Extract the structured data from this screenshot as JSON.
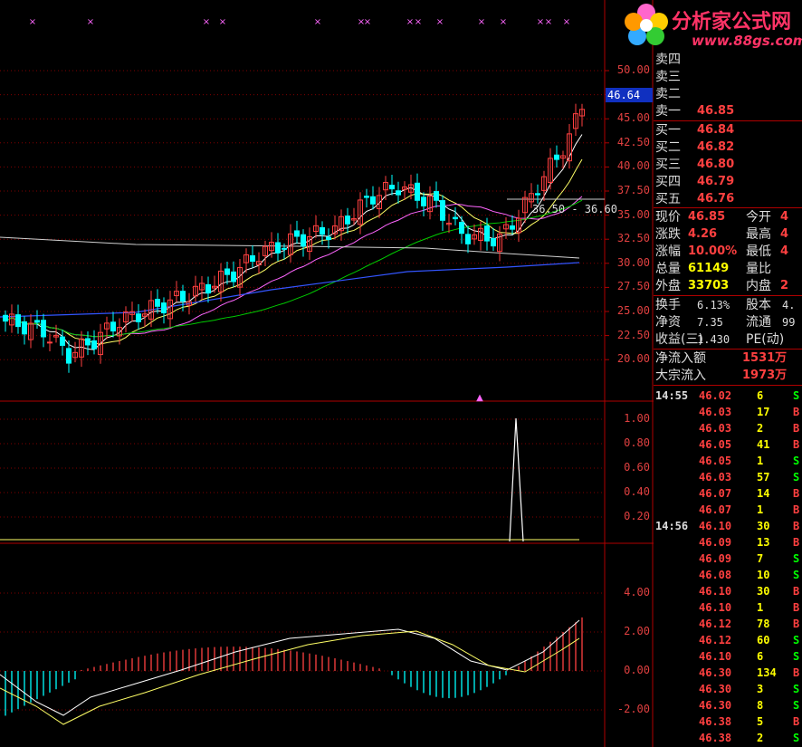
{
  "logo": {
    "title": "分析家公式网",
    "url": "www.88gs.com"
  },
  "main_panel": {
    "current_price_tag": "46.64",
    "range_label": "36.50 - 36.60",
    "y_ticks": [
      "50.00",
      "47.50",
      "45.00",
      "42.50",
      "40.00",
      "37.50",
      "35.00",
      "32.50",
      "30.00",
      "27.50",
      "25.00",
      "22.50",
      "20.00"
    ]
  },
  "sub1_ticks": [
    "1.00",
    "0.80",
    "0.60",
    "0.40",
    "0.20"
  ],
  "sub2_ticks": [
    "4.00",
    "2.00",
    "0.00",
    "-2.00"
  ],
  "quote": {
    "sell": [
      {
        "label": "卖四",
        "price": ""
      },
      {
        "label": "卖三",
        "price": ""
      },
      {
        "label": "卖二",
        "price": ""
      },
      {
        "label": "卖一",
        "price": "46.85"
      }
    ],
    "buy": [
      {
        "label": "买一",
        "price": "46.84"
      },
      {
        "label": "买二",
        "price": "46.82"
      },
      {
        "label": "买三",
        "price": "46.80"
      },
      {
        "label": "买四",
        "price": "46.79"
      },
      {
        "label": "买五",
        "price": "46.76"
      }
    ],
    "stats": [
      {
        "l1": "现价",
        "v1": "46.85",
        "l2": "今开",
        "v2": "4"
      },
      {
        "l1": "涨跌",
        "v1": "4.26",
        "l2": "最高",
        "v2": "4"
      },
      {
        "l1": "涨幅",
        "v1": "10.00%",
        "l2": "最低",
        "v2": "4"
      },
      {
        "l1": "总量",
        "v1": "61149",
        "l2": "量比",
        "v2": ""
      },
      {
        "l1": "外盘",
        "v1": "33703",
        "l2": "内盘",
        "v2": "2"
      }
    ],
    "stats2": [
      {
        "l1": "换手",
        "v1": "6.13%",
        "l2": "股本",
        "v2": "4."
      },
      {
        "l1": "净资",
        "v1": "7.35",
        "l2": "流通",
        "v2": "99"
      },
      {
        "l1": "收益(三)",
        "v1": "1.430",
        "l2": "PE(动)",
        "v2": ""
      }
    ],
    "flow": [
      {
        "label": "净流入额",
        "value": "1531万"
      },
      {
        "label": "大宗流入",
        "value": "1973万"
      }
    ]
  },
  "ticks": [
    {
      "time": "14:55",
      "price": "46.02",
      "vol": "6",
      "side": "S"
    },
    {
      "time": "",
      "price": "46.03",
      "vol": "17",
      "side": "B"
    },
    {
      "time": "",
      "price": "46.03",
      "vol": "2",
      "side": "B"
    },
    {
      "time": "",
      "price": "46.05",
      "vol": "41",
      "side": "B"
    },
    {
      "time": "",
      "price": "46.05",
      "vol": "1",
      "side": "S"
    },
    {
      "time": "",
      "price": "46.03",
      "vol": "57",
      "side": "S"
    },
    {
      "time": "",
      "price": "46.07",
      "vol": "14",
      "side": "B"
    },
    {
      "time": "",
      "price": "46.07",
      "vol": "1",
      "side": "B"
    },
    {
      "time": "14:56",
      "price": "46.10",
      "vol": "30",
      "side": "B"
    },
    {
      "time": "",
      "price": "46.09",
      "vol": "13",
      "side": "B"
    },
    {
      "time": "",
      "price": "46.09",
      "vol": "7",
      "side": "S"
    },
    {
      "time": "",
      "price": "46.08",
      "vol": "10",
      "side": "S"
    },
    {
      "time": "",
      "price": "46.10",
      "vol": "30",
      "side": "B"
    },
    {
      "time": "",
      "price": "46.10",
      "vol": "1",
      "side": "B"
    },
    {
      "time": "",
      "price": "46.12",
      "vol": "78",
      "side": "B"
    },
    {
      "time": "",
      "price": "46.12",
      "vol": "60",
      "side": "S"
    },
    {
      "time": "",
      "price": "46.10",
      "vol": "6",
      "side": "S"
    },
    {
      "time": "",
      "price": "46.30",
      "vol": "134",
      "side": "B"
    },
    {
      "time": "",
      "price": "46.30",
      "vol": "3",
      "side": "S"
    },
    {
      "time": "",
      "price": "46.30",
      "vol": "8",
      "side": "S"
    },
    {
      "time": "",
      "price": "46.38",
      "vol": "5",
      "side": "B"
    },
    {
      "time": "",
      "price": "46.38",
      "vol": "2",
      "side": "S"
    }
  ],
  "colors": {
    "up": "#ff4040",
    "down": "#00ffff",
    "grid": "#800000",
    "ma5": "#ffffff",
    "ma10": "#ffff66",
    "ma20": "#ff66ff",
    "ma60": "#00cc00",
    "ma120": "#3355ff",
    "ma250": "#d0d0d0"
  }
}
